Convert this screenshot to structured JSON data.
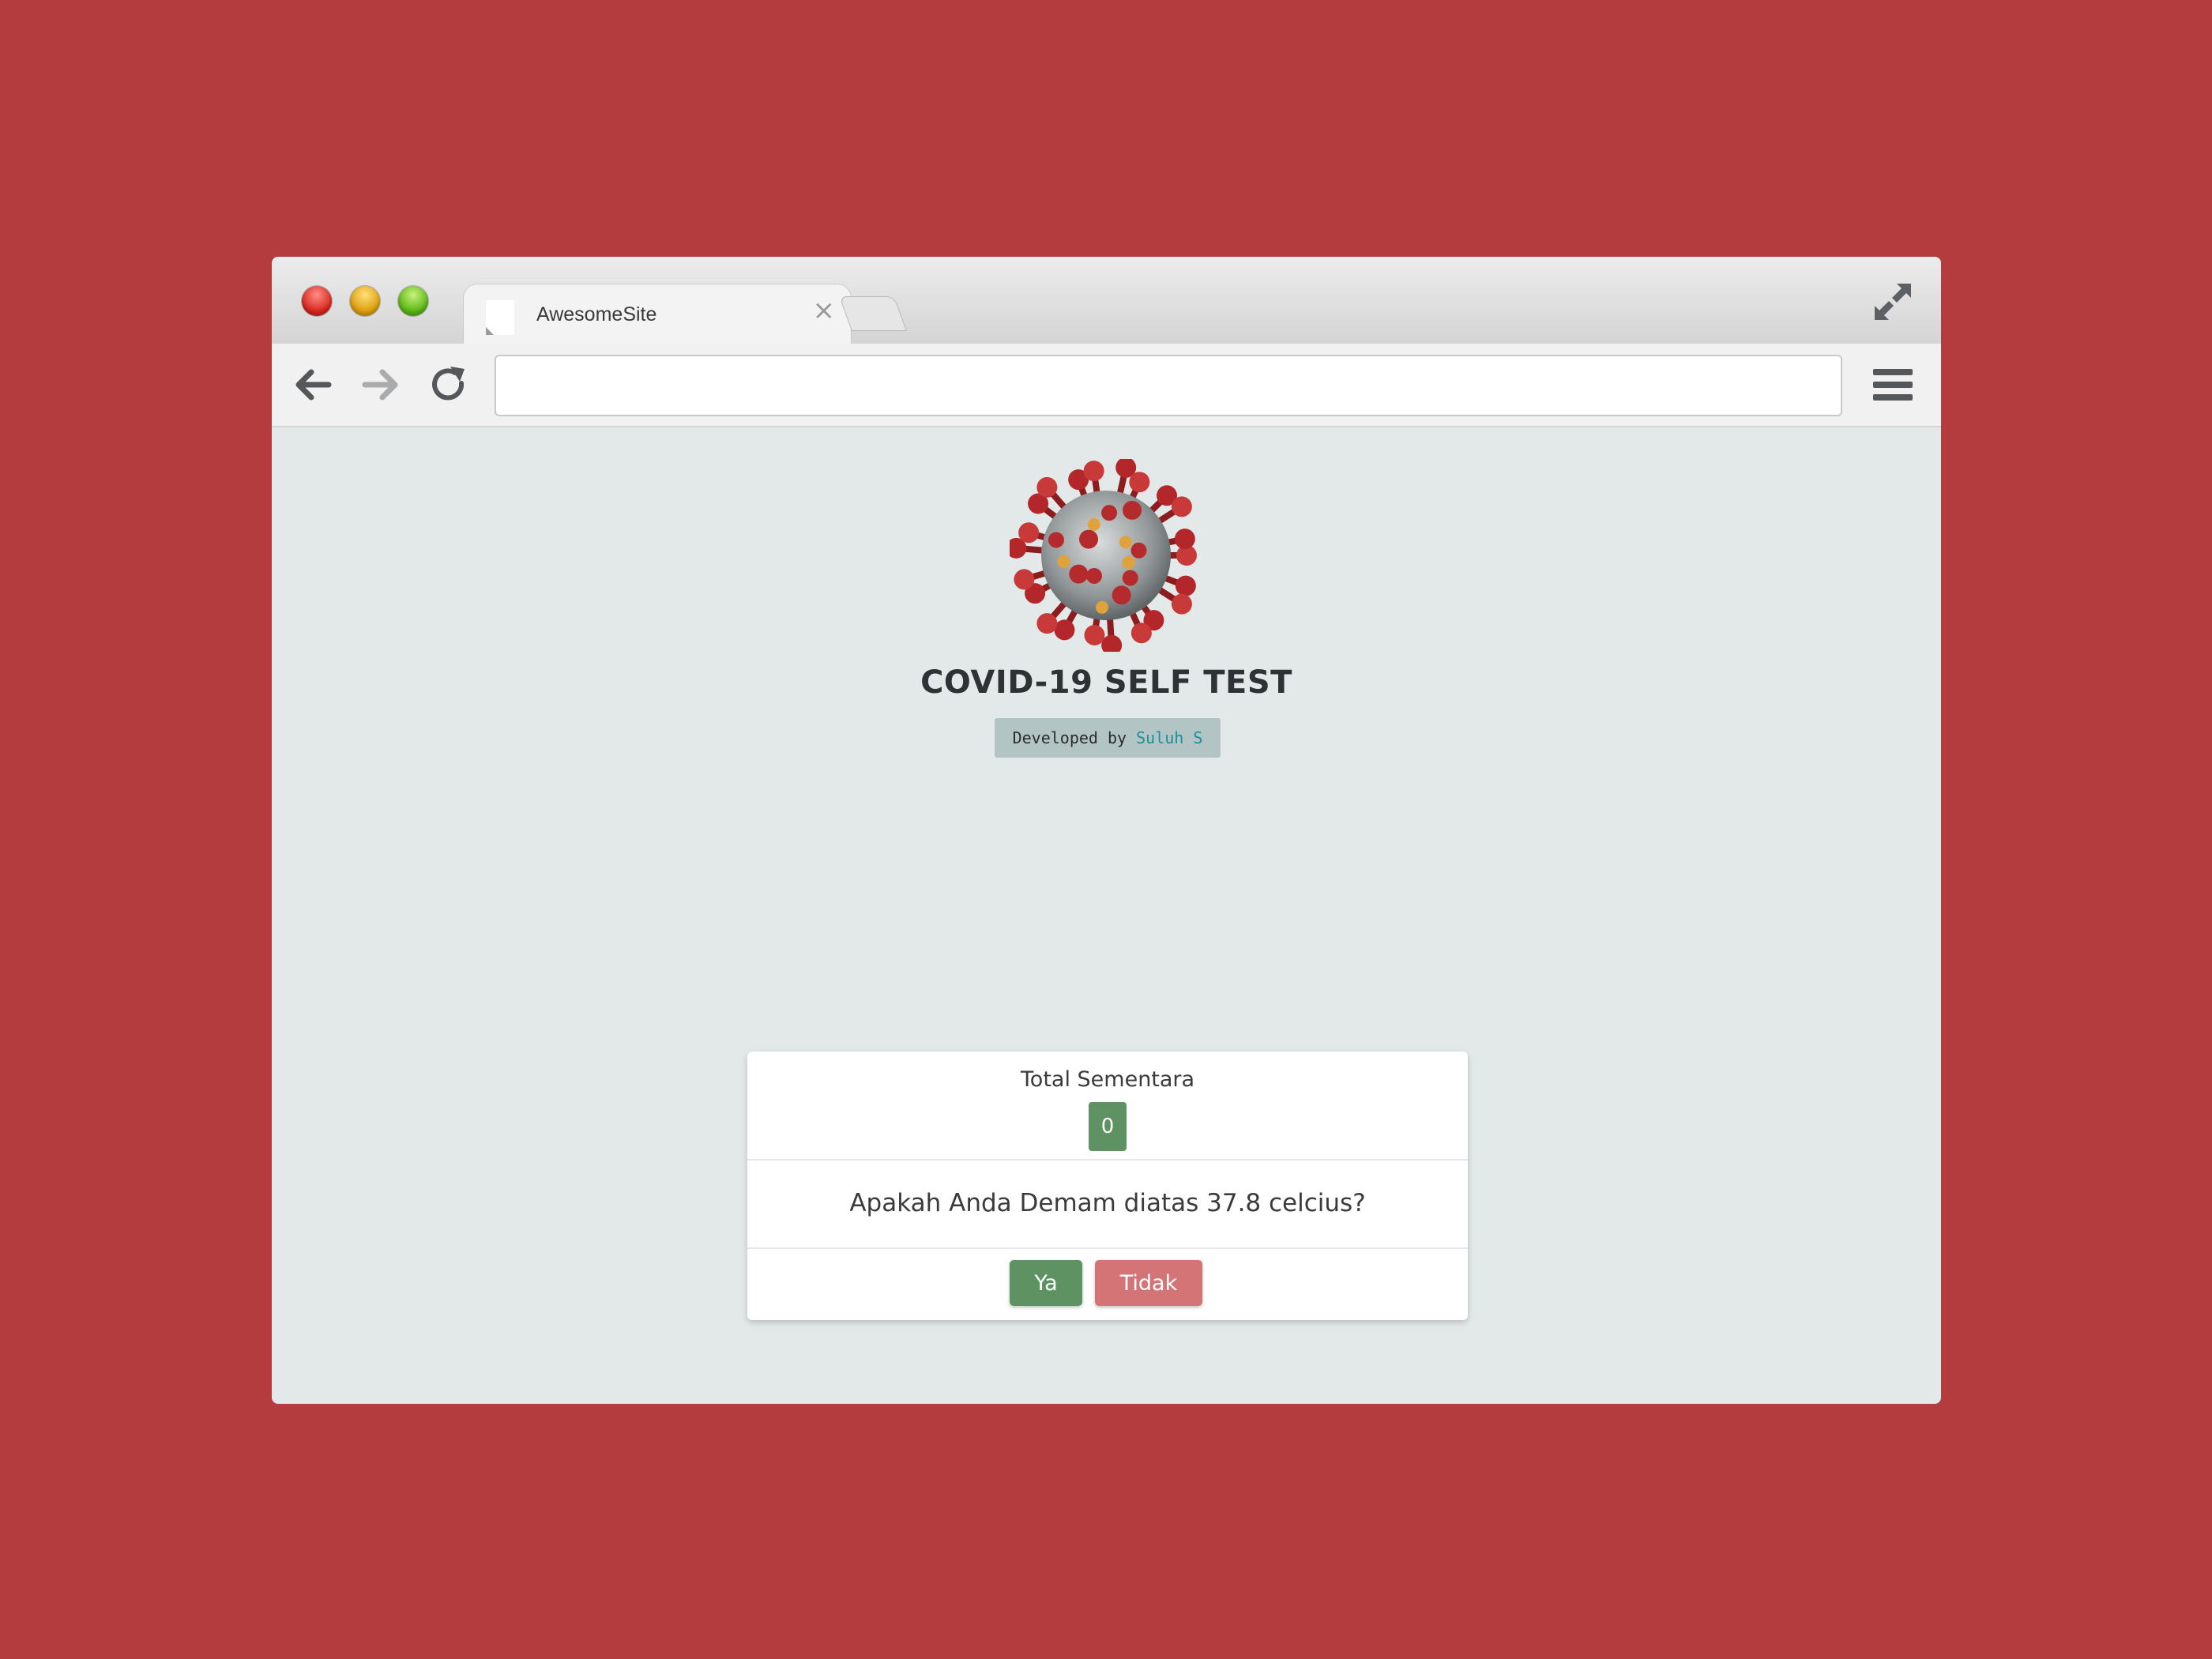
{
  "browser": {
    "tab_title": "AwesomeSite",
    "tab_close": "×",
    "address_value": ""
  },
  "page": {
    "title": "COVID-19 SELF TEST",
    "credit_prefix": "Developed by ",
    "credit_author": "Suluh S"
  },
  "card": {
    "total_label": "Total Sementara",
    "total_value": "0",
    "question": "Apakah Anda Demam diatas 37.8 celcius?",
    "yes_label": "Ya",
    "no_label": "Tidak"
  },
  "colors": {
    "background": "#b43c3e",
    "yes_button": "#5f9262",
    "no_button": "#d57477",
    "author_link": "#1c8f9a"
  },
  "icons": [
    "back-arrow-icon",
    "forward-arrow-icon",
    "reload-icon",
    "hamburger-menu-icon",
    "fullscreen-icon",
    "coronavirus-illustration"
  ]
}
